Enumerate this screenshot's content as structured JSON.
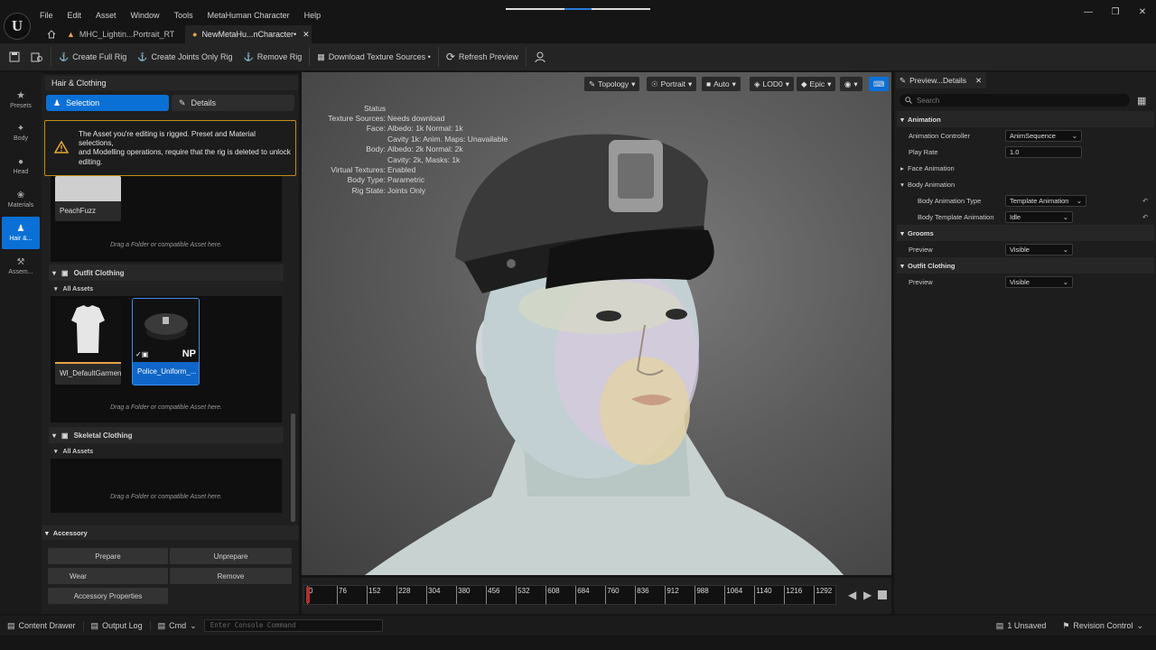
{
  "menu": [
    "File",
    "Edit",
    "Asset",
    "Window",
    "Tools",
    "MetaHuman Character",
    "Help"
  ],
  "tabs": [
    {
      "label": "MHC_Lightin...Portrait_RT"
    },
    {
      "label": "NewMetaHu...nCharacter•"
    }
  ],
  "toolbar": {
    "create_full_rig": "Create Full Rig",
    "create_joints_only_rig": "Create Joints Only Rig",
    "remove_rig": "Remove Rig",
    "download_texture_sources": "Download Texture Sources •",
    "refresh_preview": "Refresh Preview"
  },
  "sidebar": {
    "items": [
      {
        "label": "Presets",
        "icon": "star-icon"
      },
      {
        "label": "Body",
        "icon": "body-icon"
      },
      {
        "label": "Head",
        "icon": "head-icon"
      },
      {
        "label": "Materials",
        "icon": "materials-icon"
      },
      {
        "label": "Hair &...",
        "icon": "hair-clothing-icon",
        "active": true
      },
      {
        "label": "Assem...",
        "icon": "hammer-icon"
      }
    ]
  },
  "left_panel": {
    "title": "Hair & Clothing",
    "seg_selection": "Selection",
    "seg_details": "Details",
    "warning_line1": "The Asset you're editing is rigged. Preset and Material selections,",
    "warning_line2": "and Modelling operations, require that the rig is deleted to unlock editing.",
    "peachfuzz_label": "PeachFuzz",
    "drop_hint": "Drag a Folder or compatible Asset here.",
    "outfit_clothing": "Outfit Clothing",
    "all_assets": "All Assets",
    "outfit_assets": [
      {
        "label": "WI_DefaultGarment"
      },
      {
        "label": "Police_Uniform_...",
        "badge": "NP"
      }
    ],
    "skeletal_clothing": "Skeletal Clothing",
    "accessory": "Accessory",
    "accessory_buttons": {
      "prepare": "Prepare",
      "unprepare": "Unprepare",
      "wear": "Wear",
      "remove": "Remove",
      "properties": "Accessory Properties"
    }
  },
  "viewport": {
    "buttons": {
      "topology": "Topology",
      "portrait": "Portrait",
      "auto": "Auto",
      "lod": "LOD0",
      "quality": "Epic"
    },
    "status": {
      "heading": "Status",
      "rows": [
        {
          "k": "Texture Sources:",
          "v": "Needs download"
        },
        {
          "k": "Face:",
          "v": "Albedo: 1k Normal: 1k"
        },
        {
          "k": "",
          "v": "Cavity 1k: Anim. Maps: Unavailable"
        },
        {
          "k": "Body:",
          "v": "Albedo: 2k Normal: 2k"
        },
        {
          "k": "",
          "v": "Cavity: 2k, Masks: 1k"
        },
        {
          "k": "Virtual Textures:",
          "v": "Enabled"
        },
        {
          "k": "Body Type:",
          "v": "Parametric"
        },
        {
          "k": "Rig State:",
          "v": "Joints Only"
        }
      ]
    }
  },
  "timeline": {
    "ticks": [
      "0",
      "76",
      "152",
      "228",
      "304",
      "380",
      "456",
      "532",
      "608",
      "684",
      "760",
      "836",
      "912",
      "988",
      "1064",
      "1140",
      "1216",
      "1292"
    ]
  },
  "details": {
    "tab": "Preview...Details",
    "search_placeholder": "Search",
    "animation": "Animation",
    "animation_controller_label": "Animation Controller",
    "animation_controller_value": "AnimSequence",
    "play_rate_label": "Play Rate",
    "play_rate_value": "1.0",
    "face_animation": "Face Animation",
    "body_animation": "Body Animation",
    "body_anim_type_label": "Body Animation Type",
    "body_anim_type_value": "Template Animation",
    "body_template_label": "Body Template Animation",
    "body_template_value": "Idle",
    "grooms": "Grooms",
    "grooms_preview_label": "Preview",
    "grooms_preview_value": "Visible",
    "outfit_clothing": "Outfit Clothing",
    "outfit_preview_label": "Preview",
    "outfit_preview_value": "Visible"
  },
  "statusbar": {
    "content_drawer": "Content Drawer",
    "output_log": "Output Log",
    "cmd": "Cmd",
    "console_placeholder": "Enter Console Command",
    "unsaved": "1 Unsaved",
    "revision_control": "Revision Control"
  }
}
